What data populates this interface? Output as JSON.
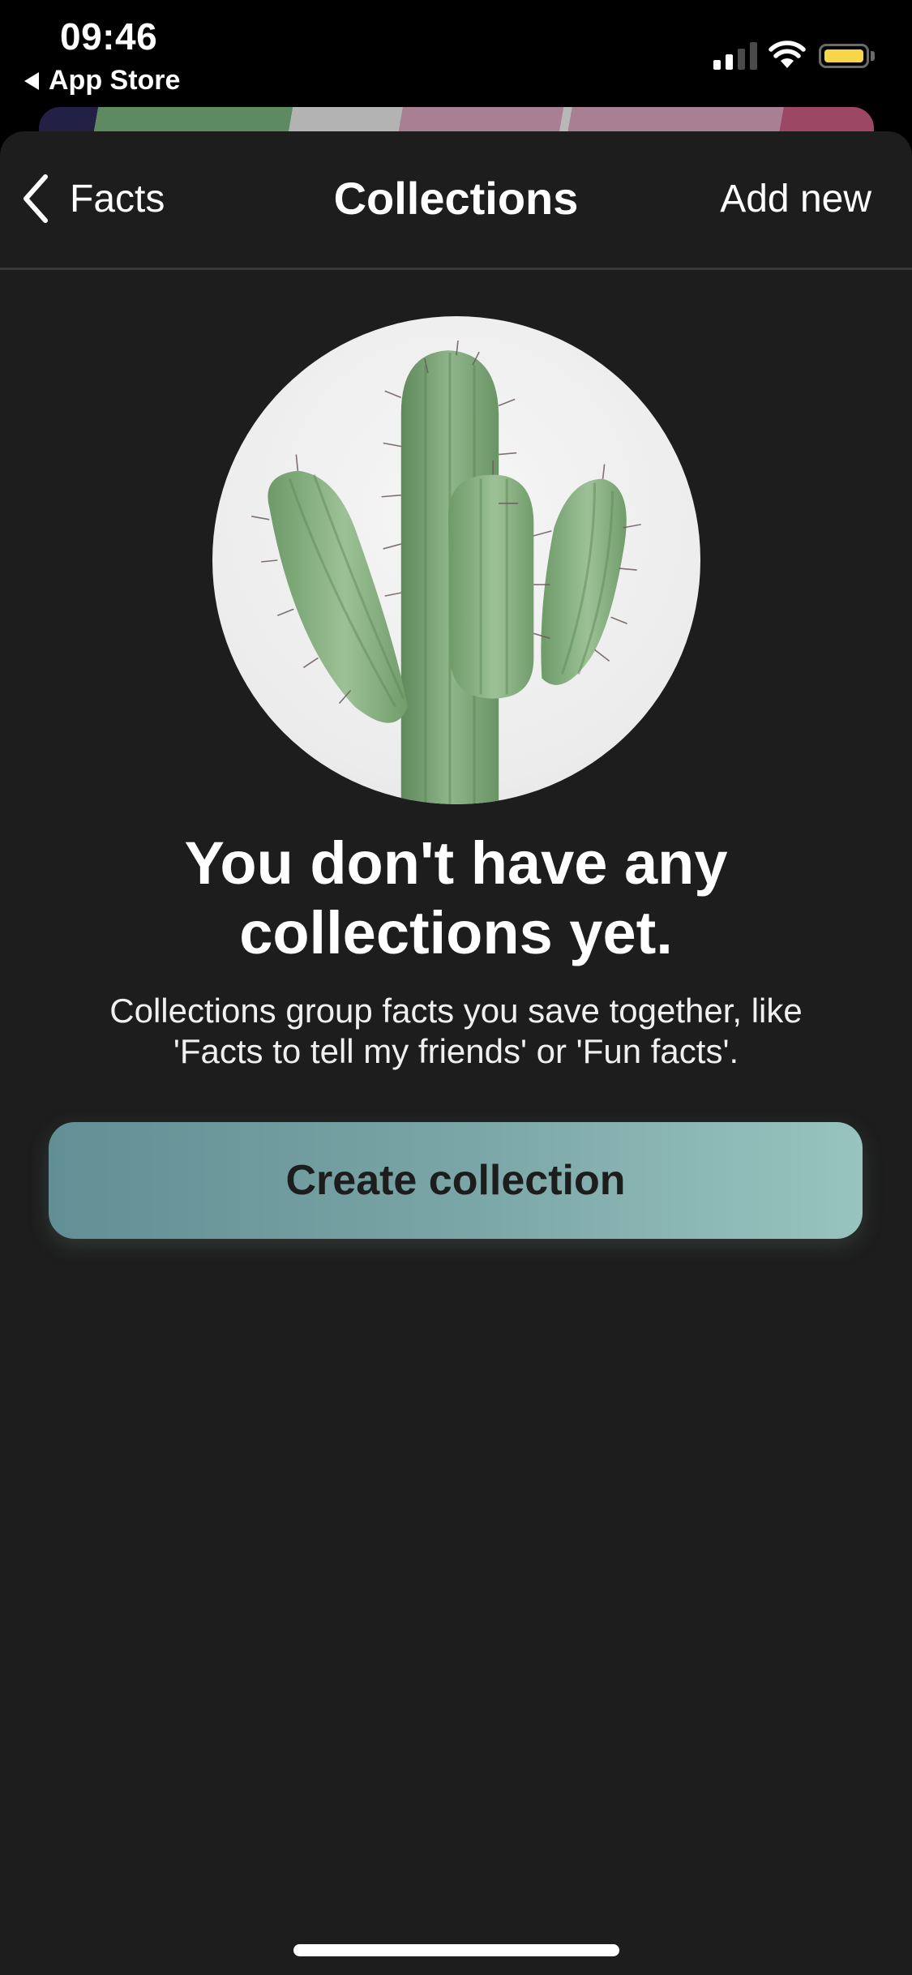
{
  "status_bar": {
    "time": "09:46",
    "back_app_label": "App Store",
    "signal_bars_active": 2,
    "signal_bars_total": 4,
    "battery_color": "#f7d64a"
  },
  "nav": {
    "back_label": "Facts",
    "title": "Collections",
    "action_label": "Add new"
  },
  "empty_state": {
    "image": "cactus-photo",
    "title_line1": "You don't have any",
    "title_line2": "collections yet.",
    "description_line1": "Collections group facts you save together, like",
    "description_line2": "'Facts to tell my friends' or 'Fun facts'.",
    "button_label": "Create collection"
  },
  "colors": {
    "background": "#1d1d1d",
    "button_gradient_start": "#628f95",
    "button_gradient_end": "#98c4bf",
    "button_text": "#1d1d1d"
  }
}
